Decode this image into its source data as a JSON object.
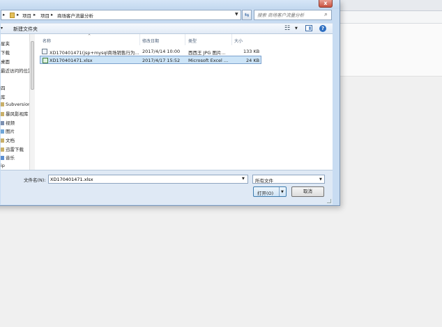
{
  "dialog": {
    "close_glyph": "x",
    "address": {
      "back_glyph": "▸",
      "segments": [
        "项目",
        "项目",
        "商场客户流量分析"
      ],
      "separator": "▸"
    },
    "refresh_glyph": "⇆",
    "search_placeholder": "搜索 商场客户流量分析",
    "search_glyph": "⌕",
    "command_bar": {
      "new_folder_label": "新建文件夹",
      "view_glyph": "☷",
      "help_glyph": "?"
    },
    "nav_items": [
      {
        "label": "星夹",
        "icon": "folder-icon"
      },
      {
        "label": "下载",
        "icon": "download-folder-icon"
      },
      {
        "label": "桌面",
        "icon": "desktop-icon"
      },
      {
        "label": "最近访问的位置",
        "icon": "recent-places-icon"
      },
      {
        "label": "",
        "icon": ""
      },
      {
        "label": "四",
        "icon": "library-icon"
      },
      {
        "label": "库",
        "icon": "library-icon"
      },
      {
        "label": "Subversion",
        "icon": "library-icon"
      },
      {
        "label": "暴风影视库",
        "icon": "library-icon"
      },
      {
        "label": "视频",
        "icon": "video-library-icon"
      },
      {
        "label": "图片",
        "icon": "picture-library-icon"
      },
      {
        "label": "文档",
        "icon": "document-library-icon"
      },
      {
        "label": "迅雷下载",
        "icon": "download-library-icon"
      },
      {
        "label": "音乐",
        "icon": "music-library-icon"
      },
      {
        "label": "ip",
        "icon": "network-icon"
      }
    ],
    "columns": {
      "name": "名称",
      "date": "修改日期",
      "type": "类型",
      "size": "大小"
    },
    "files": [
      {
        "name": "XD170401471(jsp+mysql商场销售行为...",
        "date": "2017/4/14 10:00",
        "type": "西西王 JPG 图片...",
        "size": "133 KB",
        "icon": "image-file-icon",
        "selected": false
      },
      {
        "name": "XD170401471.xlsx",
        "date": "2017/4/17 15:52",
        "type": "Microsoft Excel ...",
        "size": "24 KB",
        "icon": "excel-file-icon",
        "selected": true
      }
    ],
    "filename_label": "文件名(N):",
    "filename_value": "XD170401471.xlsx",
    "filetype_value": "所有文件",
    "open_label": "打开(O)",
    "cancel_label": "取消"
  },
  "colors": {
    "selection": "#cce4f7",
    "dialog_frame": "#c8dcf2",
    "accent": "#2f6fc1"
  }
}
